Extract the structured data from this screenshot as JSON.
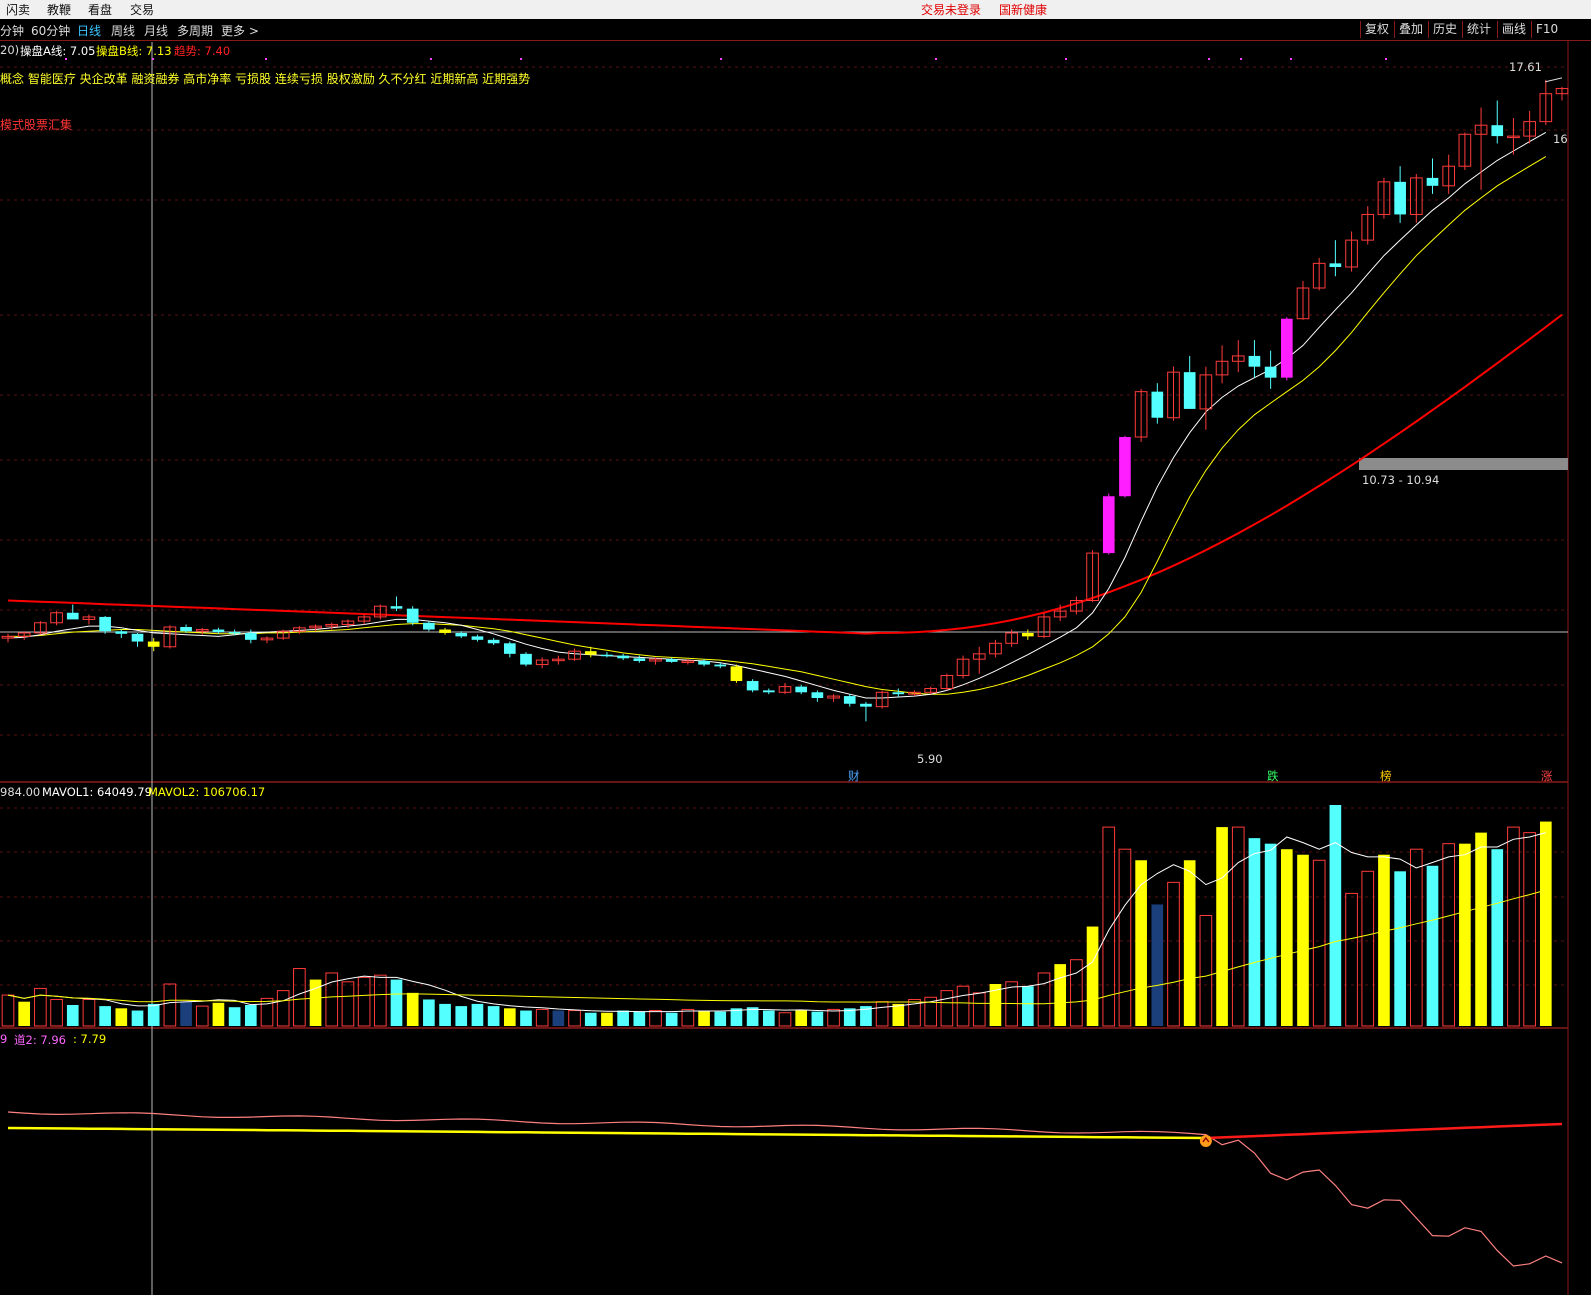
{
  "menu": {
    "items": [
      "闪卖",
      "教鞭",
      "看盘",
      "交易"
    ],
    "status_text": "交易未登录",
    "stock_name": "国新健康"
  },
  "periods": {
    "tabs": [
      "分钟",
      "60分钟",
      "日线",
      "周线",
      "月线",
      "多周期",
      "更多 >"
    ],
    "active": "日线"
  },
  "tools": [
    "复权",
    "叠加",
    "历史",
    "统计",
    "画线",
    "F10"
  ],
  "main_panel": {
    "params": "20)",
    "line_a_label": "操盘A线: 7.05",
    "line_b_label": "操盘B线: 7.13",
    "trend_label": "趋势: 7.40",
    "concepts": "概念 智能医疗 央企改革  融资融券 高市净率 亏损股 连续亏损 股权激励 久不分红 近期新高 近期强势",
    "summary_link": "模式股票汇集",
    "high_label": "17.61",
    "right_partial_label": "16",
    "low_label": "5.90",
    "range_label": "10.73 - 10.94",
    "event_markers": [
      "财",
      "跌",
      "榜",
      "涨"
    ],
    "colors": {
      "up_candle": "#ff3b3b",
      "down_candle": "#54ffff",
      "limit_up_candle": "#ff1eff",
      "flat_yellow": "#ffff00",
      "ma_white": "#ffffff",
      "ma_yellow": "#ffff00",
      "ma_red": "#ff0000"
    }
  },
  "volume_panel": {
    "vol_label": "984.00",
    "mavol1_label": "MAVOL1: 64049.79",
    "mavol2_label": "MAVOL2: 106706.17"
  },
  "indicator_panel": {
    "label1": "9",
    "label2": "道2: 7.96",
    "label3": ": 7.79"
  },
  "chart_data": {
    "type": "candlestick",
    "ohlc": [
      [
        6.8,
        6.85,
        6.75,
        6.82
      ],
      [
        6.82,
        6.88,
        6.78,
        6.86
      ],
      [
        6.86,
        7.0,
        6.84,
        6.98
      ],
      [
        6.98,
        7.12,
        6.95,
        7.1
      ],
      [
        7.1,
        7.2,
        7.05,
        7.02
      ],
      [
        7.02,
        7.08,
        6.96,
        7.05
      ],
      [
        7.05,
        7.06,
        6.85,
        6.88
      ],
      [
        6.88,
        6.9,
        6.8,
        6.85
      ],
      [
        6.85,
        6.86,
        6.7,
        6.76
      ],
      [
        6.76,
        6.8,
        6.65,
        6.7
      ],
      [
        6.7,
        6.95,
        6.68,
        6.93
      ],
      [
        6.93,
        6.96,
        6.86,
        6.88
      ],
      [
        6.88,
        6.92,
        6.84,
        6.9
      ],
      [
        6.9,
        6.92,
        6.85,
        6.87
      ],
      [
        6.87,
        6.9,
        6.83,
        6.86
      ],
      [
        6.86,
        6.9,
        6.74,
        6.78
      ],
      [
        6.78,
        6.82,
        6.74,
        6.8
      ],
      [
        6.8,
        6.9,
        6.78,
        6.88
      ],
      [
        6.88,
        6.94,
        6.85,
        6.92
      ],
      [
        6.92,
        6.96,
        6.88,
        6.94
      ],
      [
        6.94,
        6.98,
        6.9,
        6.96
      ],
      [
        6.96,
        7.02,
        6.92,
        7.0
      ],
      [
        7.0,
        7.08,
        6.96,
        7.05
      ],
      [
        7.05,
        7.2,
        7.02,
        7.18
      ],
      [
        7.18,
        7.3,
        7.12,
        7.15
      ],
      [
        7.15,
        7.18,
        6.95,
        6.98
      ],
      [
        6.98,
        7.0,
        6.88,
        6.9
      ],
      [
        6.9,
        6.92,
        6.84,
        6.86
      ],
      [
        6.86,
        6.88,
        6.8,
        6.82
      ],
      [
        6.82,
        6.84,
        6.76,
        6.78
      ],
      [
        6.78,
        6.8,
        6.72,
        6.74
      ],
      [
        6.74,
        6.76,
        6.58,
        6.62
      ],
      [
        6.62,
        6.64,
        6.48,
        6.5
      ],
      [
        6.5,
        6.58,
        6.46,
        6.55
      ],
      [
        6.55,
        6.6,
        6.5,
        6.56
      ],
      [
        6.56,
        6.68,
        6.54,
        6.65
      ],
      [
        6.65,
        6.7,
        6.58,
        6.61
      ],
      [
        6.61,
        6.64,
        6.58,
        6.6
      ],
      [
        6.6,
        6.62,
        6.55,
        6.57
      ],
      [
        6.57,
        6.6,
        6.52,
        6.54
      ],
      [
        6.54,
        6.58,
        6.5,
        6.56
      ],
      [
        6.56,
        6.58,
        6.52,
        6.53
      ],
      [
        6.53,
        6.56,
        6.5,
        6.54
      ],
      [
        6.54,
        6.56,
        6.48,
        6.5
      ],
      [
        6.5,
        6.52,
        6.46,
        6.48
      ],
      [
        6.48,
        6.5,
        6.3,
        6.32
      ],
      [
        6.32,
        6.34,
        6.2,
        6.22
      ],
      [
        6.22,
        6.24,
        6.18,
        6.2
      ],
      [
        6.2,
        6.3,
        6.18,
        6.26
      ],
      [
        6.26,
        6.28,
        6.18,
        6.2
      ],
      [
        6.2,
        6.22,
        6.1,
        6.14
      ],
      [
        6.14,
        6.18,
        6.1,
        6.16
      ],
      [
        6.16,
        6.18,
        6.05,
        6.08
      ],
      [
        6.08,
        6.1,
        5.9,
        6.05
      ],
      [
        6.05,
        6.22,
        6.03,
        6.2
      ],
      [
        6.2,
        6.24,
        6.15,
        6.18
      ],
      [
        6.18,
        6.22,
        6.16,
        6.2
      ],
      [
        6.2,
        6.26,
        6.18,
        6.24
      ],
      [
        6.24,
        6.4,
        6.22,
        6.38
      ],
      [
        6.38,
        6.6,
        6.35,
        6.56
      ],
      [
        6.56,
        6.7,
        6.4,
        6.62
      ],
      [
        6.62,
        6.78,
        6.58,
        6.74
      ],
      [
        6.74,
        6.9,
        6.7,
        6.86
      ],
      [
        6.86,
        6.9,
        6.78,
        6.82
      ],
      [
        6.82,
        7.1,
        6.8,
        7.05
      ],
      [
        7.05,
        7.2,
        7.0,
        7.12
      ],
      [
        7.12,
        7.3,
        7.08,
        7.25
      ],
      [
        7.25,
        7.9,
        7.23,
        7.86
      ],
      [
        7.86,
        8.7,
        7.84,
        8.66
      ],
      [
        8.66,
        9.6,
        8.64,
        9.58
      ],
      [
        9.58,
        10.4,
        9.5,
        10.35
      ],
      [
        10.35,
        10.5,
        9.8,
        9.9
      ],
      [
        9.9,
        10.8,
        9.85,
        10.7
      ],
      [
        10.7,
        11.0,
        10.4,
        10.05
      ],
      [
        10.05,
        10.8,
        9.7,
        10.65
      ],
      [
        10.65,
        11.2,
        10.5,
        10.9
      ],
      [
        10.9,
        11.3,
        10.7,
        11.0
      ],
      [
        11.0,
        11.3,
        10.6,
        10.8
      ],
      [
        10.8,
        11.1,
        10.4,
        10.6
      ],
      [
        10.6,
        11.75,
        10.55,
        11.72
      ],
      [
        11.72,
        12.5,
        11.7,
        12.35
      ],
      [
        12.35,
        13.0,
        12.3,
        12.88
      ],
      [
        12.88,
        13.4,
        12.6,
        12.8
      ],
      [
        12.8,
        13.6,
        12.7,
        13.4
      ],
      [
        13.4,
        14.2,
        13.3,
        14.0
      ],
      [
        14.0,
        14.9,
        13.9,
        14.8
      ],
      [
        14.8,
        15.2,
        13.8,
        14.0
      ],
      [
        14.0,
        15.0,
        13.8,
        14.9
      ],
      [
        14.9,
        15.4,
        14.5,
        14.7
      ],
      [
        14.7,
        15.5,
        14.5,
        15.2
      ],
      [
        15.2,
        16.1,
        15.1,
        16.05
      ],
      [
        16.05,
        16.8,
        14.6,
        16.3
      ],
      [
        16.3,
        17.0,
        15.8,
        16.0
      ],
      [
        16.0,
        16.5,
        15.5,
        16.0
      ],
      [
        16.0,
        16.7,
        15.8,
        16.4
      ],
      [
        16.4,
        17.61,
        16.3,
        17.2
      ],
      [
        17.2,
        17.4,
        17.0,
        17.35
      ]
    ],
    "volume": [
      28000,
      22000,
      34000,
      24000,
      19000,
      24000,
      18000,
      16000,
      14000,
      20000,
      38000,
      22000,
      18000,
      21000,
      17000,
      19000,
      25000,
      32000,
      52000,
      42000,
      48000,
      40000,
      44000,
      46000,
      42000,
      30000,
      24000,
      20000,
      18000,
      20000,
      18000,
      16000,
      14000,
      15000,
      14000,
      14000,
      12000,
      12000,
      14000,
      13000,
      14000,
      12000,
      15000,
      14000,
      13000,
      16000,
      17000,
      14000,
      12000,
      14000,
      13000,
      15000,
      16000,
      18000,
      22000,
      20000,
      24000,
      26000,
      32000,
      36000,
      30000,
      38000,
      40000,
      36000,
      48000,
      56000,
      60000,
      90000,
      180000,
      160000,
      150000,
      110000,
      130000,
      150000,
      100000,
      180000,
      180000,
      170000,
      165000,
      160000,
      155000,
      150000,
      200000,
      120000,
      140000,
      155000,
      140000,
      160000,
      145000,
      165000,
      165000,
      175000,
      160000,
      180000,
      175000,
      185000
    ],
    "ma_white": [
      6.8,
      6.81,
      6.84,
      6.88,
      6.91,
      6.94,
      6.94,
      6.92,
      6.89,
      6.86,
      6.85,
      6.84,
      6.83,
      6.82,
      6.84,
      6.86,
      6.87,
      6.88,
      6.89,
      6.9,
      6.92,
      6.94,
      6.96,
      6.99,
      7.02,
      7.02,
      7.0,
      6.98,
      6.95,
      6.9,
      6.85,
      6.79,
      6.73,
      6.68,
      6.64,
      6.62,
      6.61,
      6.6,
      6.59,
      6.58,
      6.57,
      6.56,
      6.55,
      6.54,
      6.52,
      6.49,
      6.45,
      6.41,
      6.37,
      6.32,
      6.27,
      6.22,
      6.18,
      6.14,
      6.14,
      6.15,
      6.16,
      6.18,
      6.22,
      6.28,
      6.35,
      6.43,
      6.52,
      6.61,
      6.71,
      6.81,
      6.92,
      7.1,
      7.4,
      7.8,
      8.3,
      8.8,
      9.25,
      9.65,
      10.0,
      10.25,
      10.45,
      10.6,
      10.75,
      10.95,
      11.2,
      11.55,
      11.9,
      12.25,
      12.65,
      13.05,
      13.4,
      13.75,
      14.1,
      14.4,
      14.75,
      15.05,
      15.35,
      15.6,
      15.85,
      16.1
    ],
    "ma_yellow": [
      6.82,
      6.82,
      6.83,
      6.85,
      6.87,
      6.88,
      6.89,
      6.9,
      6.9,
      6.89,
      6.88,
      6.87,
      6.86,
      6.85,
      6.85,
      6.85,
      6.86,
      6.86,
      6.87,
      6.88,
      6.89,
      6.9,
      6.92,
      6.94,
      6.96,
      6.97,
      6.97,
      6.96,
      6.95,
      6.93,
      6.91,
      6.88,
      6.84,
      6.8,
      6.76,
      6.72,
      6.69,
      6.66,
      6.63,
      6.61,
      6.59,
      6.58,
      6.57,
      6.56,
      6.55,
      6.53,
      6.51,
      6.48,
      6.45,
      6.42,
      6.38,
      6.34,
      6.3,
      6.26,
      6.23,
      6.21,
      6.19,
      6.18,
      6.18,
      6.2,
      6.23,
      6.27,
      6.32,
      6.38,
      6.45,
      6.52,
      6.6,
      6.7,
      6.85,
      7.05,
      7.35,
      7.75,
      8.2,
      8.65,
      9.05,
      9.4,
      9.7,
      9.95,
      10.15,
      10.35,
      10.55,
      10.8,
      11.1,
      11.45,
      11.85,
      12.25,
      12.65,
      13.05,
      13.4,
      13.75,
      14.1,
      14.4,
      14.7,
      14.95,
      15.2,
      15.45
    ],
    "ma_red_end": 11.8,
    "indicator_signal_index": 74,
    "ylim": [
      5.6,
      18.0
    ]
  }
}
